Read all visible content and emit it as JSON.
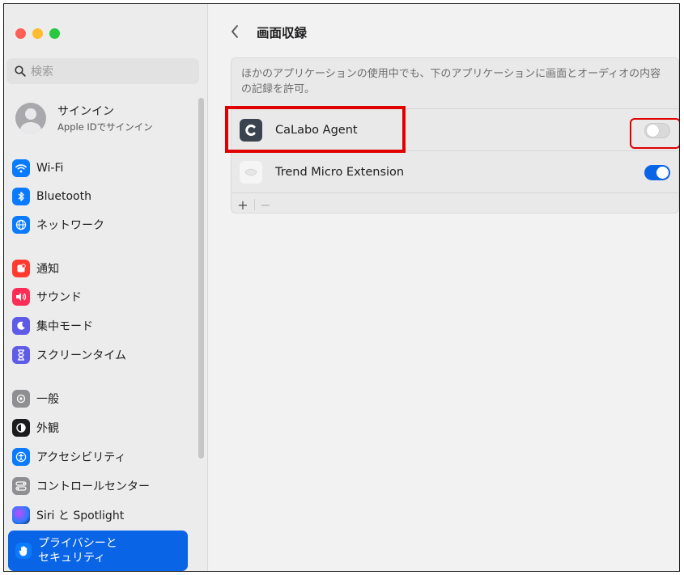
{
  "colors": {
    "accent": "#0a64e6",
    "highlight": "#e10000"
  },
  "sidebar": {
    "search_placeholder": "検索",
    "account": {
      "name": "サインイン",
      "subtitle": "Apple IDでサインイン"
    },
    "items": [
      {
        "label": "Wi-Fi",
        "icon": "wifi-icon",
        "color": "#0a7aff"
      },
      {
        "label": "Bluetooth",
        "icon": "bluetooth-icon",
        "color": "#0a7aff"
      },
      {
        "label": "ネットワーク",
        "icon": "globe-icon",
        "color": "#0a7aff"
      },
      {
        "label": "通知",
        "icon": "bell-icon",
        "color": "#ff3b30"
      },
      {
        "label": "サウンド",
        "icon": "speaker-icon",
        "color": "#ff2d55"
      },
      {
        "label": "集中モード",
        "icon": "moon-icon",
        "color": "#5e5ce6"
      },
      {
        "label": "スクリーンタイム",
        "icon": "hourglass-icon",
        "color": "#5e5ce6"
      },
      {
        "label": "一般",
        "icon": "gear-icon",
        "color": "#8e8e93"
      },
      {
        "label": "外観",
        "icon": "appearance-icon",
        "color": "#1c1c1e"
      },
      {
        "label": "アクセシビリティ",
        "icon": "accessibility-icon",
        "color": "#0a7aff"
      },
      {
        "label": "コントロールセンター",
        "icon": "control-center-icon",
        "color": "#8e8e93"
      },
      {
        "label": "Siri と Spotlight",
        "icon": "siri-icon",
        "color": "#3a3a8c"
      },
      {
        "label_line1": "プライバシーと",
        "label_line2": "セキュリティ",
        "icon": "hand-icon",
        "color": "#0a7aff",
        "selected": true
      }
    ]
  },
  "main": {
    "title": "画面収録",
    "description": "ほかのアプリケーションの使用中でも、下のアプリケーションに画面とオーディオの内容の記録を許可。",
    "apps": [
      {
        "name": "CaLabo Agent",
        "icon": "calabo-icon",
        "enabled": false
      },
      {
        "name": "Trend Micro Extension",
        "icon": "trend-micro-icon",
        "enabled": true
      }
    ],
    "add_label": "+",
    "remove_label": "−"
  }
}
